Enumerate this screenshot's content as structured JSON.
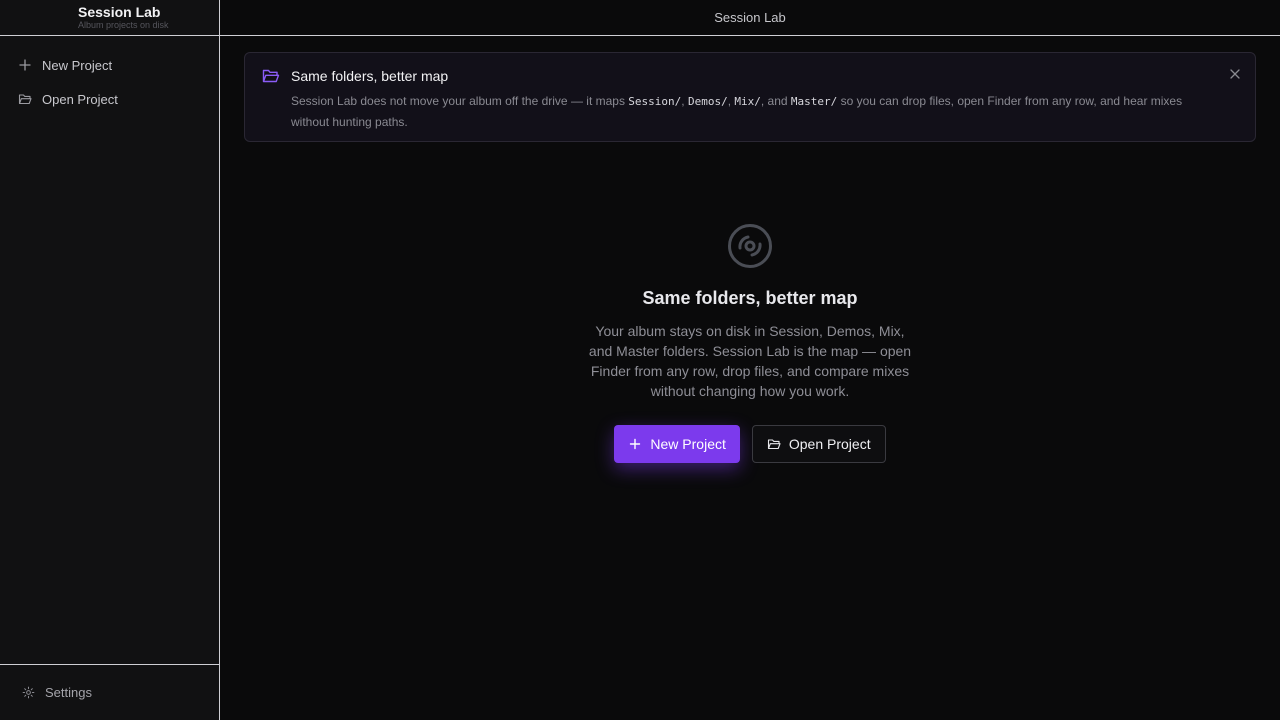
{
  "sidebar": {
    "brand_title": "Session Lab",
    "brand_subtitle": "Album projects on disk",
    "items": [
      {
        "label": "New Project",
        "icon": "plus-icon"
      },
      {
        "label": "Open Project",
        "icon": "folder-open-icon"
      }
    ],
    "settings_label": "Settings"
  },
  "topbar": {
    "title": "Session Lab"
  },
  "banner": {
    "title": "Same folders, better map",
    "text_before": "Session Lab does not move your album off the drive — it maps ",
    "folders": [
      "Session/",
      "Demos/",
      "Mix/",
      "Master/"
    ],
    "sep1": ", ",
    "sep2": ", ",
    "sep3": ", and ",
    "text_after": " so you can drop files, open Finder from any row, and hear mixes without hunting paths."
  },
  "empty_state": {
    "icon": "disc-icon",
    "title": "Same folders, better map",
    "text": "Your album stays on disk in Session, Demos, Mix, and Master folders. Session Lab is the map — open Finder from any row, drop files, and compare mixes without changing how you work.",
    "primary_button": "New Project",
    "secondary_button": "Open Project"
  },
  "colors": {
    "accent": "#7c3aed",
    "background": "#0a0a0b",
    "sidebar": "#111112"
  }
}
